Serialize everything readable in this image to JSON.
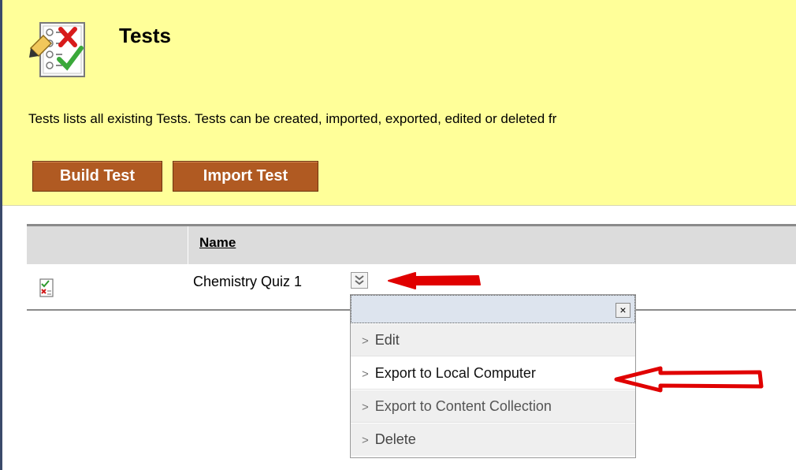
{
  "header": {
    "title": "Tests",
    "description": "Tests lists all existing Tests. Tests can be created, imported, exported, edited or deleted fr",
    "build_button": "Build Test",
    "import_button": "Import Test"
  },
  "table": {
    "columns": [
      "Name"
    ],
    "rows": [
      {
        "name": "Chemistry Quiz 1"
      }
    ]
  },
  "context_menu": {
    "close_label": "×",
    "items": [
      {
        "label": "Edit"
      },
      {
        "label": "Export to Local Computer"
      },
      {
        "label": "Export to Content Collection"
      },
      {
        "label": "Delete"
      }
    ]
  },
  "colors": {
    "header_bg": "#ffff99",
    "button_bg": "#b05a22",
    "annotation_arrow": "#e00000"
  },
  "icons": [
    "tests-icon",
    "test-row-icon",
    "chevron-down-icon",
    "close-icon",
    "chevron-right-icon",
    "red-arrow-annotation"
  ]
}
